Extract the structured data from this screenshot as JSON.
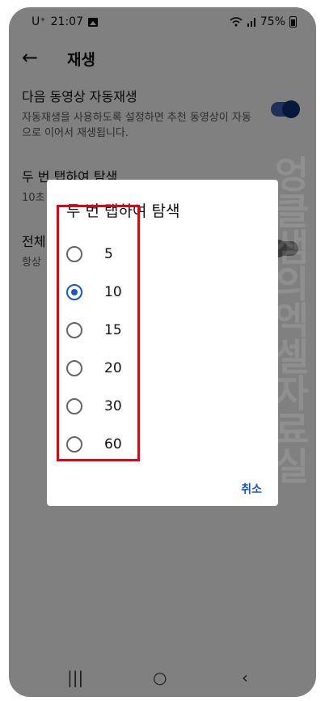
{
  "status": {
    "carrier": "U⁺",
    "time": "21:07",
    "battery": "75%",
    "icons": [
      "image-icon",
      "wifi-icon",
      "signal-icon",
      "battery-icon"
    ]
  },
  "appbar": {
    "title": "재생",
    "back_icon": "back-arrow-icon"
  },
  "settings": [
    {
      "title": "다음 동영상 자동재생",
      "desc": "자동재생을 사용하도록 설정하면 추천 동영상이 자동으로 이어서 재생됩니다.",
      "toggle": true
    },
    {
      "title": "두 번 탭하여 탐색",
      "desc": "10초"
    },
    {
      "title": "전체",
      "desc": "항상",
      "toggle": false
    }
  ],
  "dialog": {
    "title": "두 번 탭하여 탐색",
    "options": [
      "5",
      "10",
      "15",
      "20",
      "30",
      "60"
    ],
    "selected": "10",
    "cancel": "취소"
  },
  "watermark": "엉클샘의엑셀자료실",
  "navbar": {
    "recents": "|||",
    "home": "○",
    "back": "‹"
  },
  "colors": {
    "accent": "#1a57c9",
    "highlight": "#e60012",
    "scrim": "rgba(0,0,0,0.47)"
  }
}
